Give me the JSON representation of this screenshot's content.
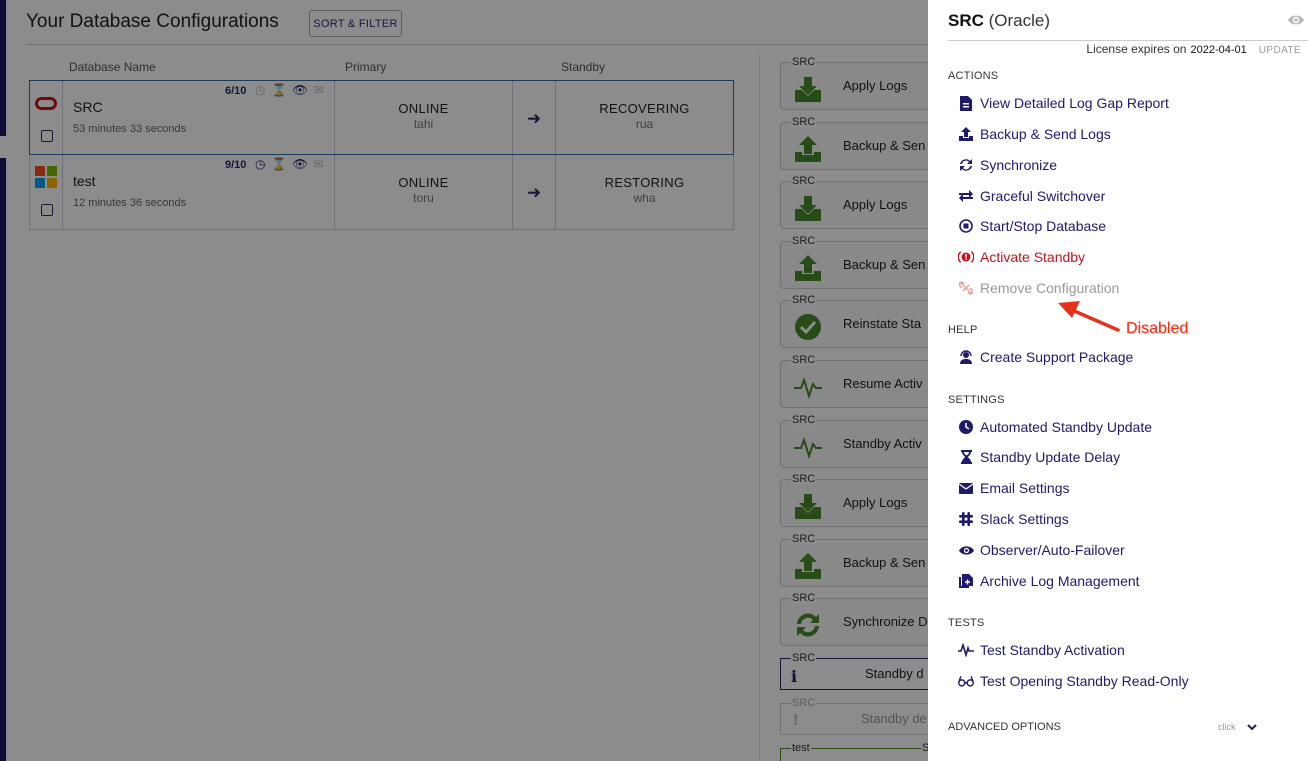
{
  "background": {
    "page_title": "Your Database Configurations",
    "sort_filter_label": "SORT & FILTER",
    "columns": {
      "name": "Database Name",
      "primary": "Primary",
      "standby": "Standby"
    },
    "rows": [
      {
        "name": "SRC",
        "elapsed": "53 minutes 33 seconds",
        "score": "6/10",
        "primary_status": "ONLINE",
        "primary_host": "tahi",
        "standby_status": "RECOVERING",
        "standby_host": "rua",
        "platform_icon": "oracle-logo"
      },
      {
        "name": "test",
        "elapsed": "12 minutes 36 seconds",
        "score": "9/10",
        "primary_status": "ONLINE",
        "primary_host": "toru",
        "standby_status": "RESTORING",
        "standby_host": "wha",
        "platform_icon": "windows-logo"
      }
    ],
    "activity_cards": [
      {
        "src": "SRC",
        "label": "Apply Logs",
        "icon": "download-icon"
      },
      {
        "src": "SRC",
        "label": "Backup & Sen",
        "icon": "upload-icon"
      },
      {
        "src": "SRC",
        "label": "Apply Logs",
        "icon": "download-icon"
      },
      {
        "src": "SRC",
        "label": "Backup & Sen",
        "icon": "upload-icon"
      },
      {
        "src": "SRC",
        "label": "Reinstate Sta",
        "icon": "check-circle-icon"
      },
      {
        "src": "SRC",
        "label": "Resume Activ",
        "icon": "pulse-icon"
      },
      {
        "src": "SRC",
        "label": "Standby Activ",
        "icon": "pulse-icon"
      },
      {
        "src": "SRC",
        "label": "Apply Logs",
        "icon": "download-icon"
      },
      {
        "src": "SRC",
        "label": "Backup & Sen",
        "icon": "upload-icon"
      },
      {
        "src": "SRC",
        "label": "Synchronize D",
        "icon": "sync-icon"
      }
    ],
    "notice_cards": [
      {
        "src": "SRC",
        "label": "Standby d",
        "icon": "info-icon"
      },
      {
        "src": "SRC",
        "label": "Standby de",
        "icon": "warning-icon"
      },
      {
        "src": "test",
        "label": "S"
      }
    ]
  },
  "panel": {
    "title_name": "SRC",
    "title_type": "(Oracle)",
    "license_label": "License expires on",
    "license_date": "2022-04-01",
    "update_label": "UPDATE",
    "sections": {
      "actions": "ACTIONS",
      "help": "HELP",
      "settings": "SETTINGS",
      "tests": "TESTS",
      "advanced": "ADVANCED OPTIONS"
    },
    "actions": [
      {
        "label": "View Detailed Log Gap Report",
        "icon": "report-file-icon"
      },
      {
        "label": "Backup & Send Logs",
        "icon": "upload-icon"
      },
      {
        "label": "Synchronize",
        "icon": "sync-icon"
      },
      {
        "label": "Graceful Switchover",
        "icon": "switch-arrows-icon"
      },
      {
        "label": "Start/Stop Database",
        "icon": "stop-circle-icon"
      },
      {
        "label": "Activate Standby",
        "icon": "alert-icon"
      },
      {
        "label": "Remove Configuration",
        "icon": "unlink-icon"
      }
    ],
    "help": [
      {
        "label": "Create Support Package",
        "icon": "support-agent-icon"
      }
    ],
    "settings": [
      {
        "label": "Automated Standby Update",
        "icon": "clock-icon"
      },
      {
        "label": "Standby Update Delay",
        "icon": "hourglass-icon"
      },
      {
        "label": "Email Settings",
        "icon": "envelope-icon"
      },
      {
        "label": "Slack Settings",
        "icon": "slack-icon"
      },
      {
        "label": "Observer/Auto-Failover",
        "icon": "eye-icon"
      },
      {
        "label": "Archive Log Management",
        "icon": "archive-files-icon"
      }
    ],
    "tests": [
      {
        "label": "Test Standby Activation",
        "icon": "pulse-icon"
      },
      {
        "label": "Test Opening Standby Read-Only",
        "icon": "glasses-icon"
      }
    ],
    "advanced_hint": "click"
  },
  "annotation": {
    "text": "Disabled"
  },
  "colors": {
    "accent": "#1e1a6c",
    "danger": "#c0141b",
    "disabled": "#999999",
    "annotation": "#e4321b"
  }
}
